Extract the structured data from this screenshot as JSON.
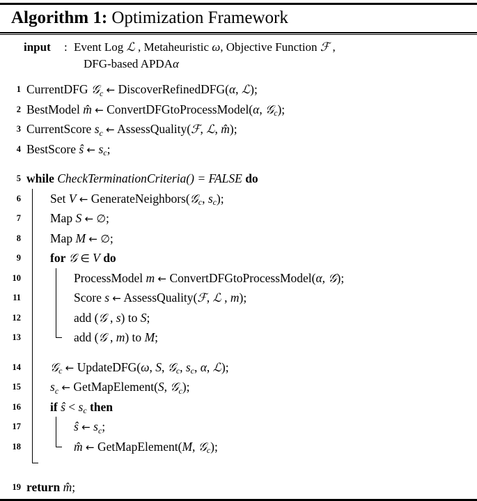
{
  "title": {
    "caption": "Algorithm 1:",
    "name": " Optimization Framework"
  },
  "input_block": {
    "keyword": "input",
    "colon": ":",
    "line1": "Event Log ℒ , Metaheuristic ω, Objective Function ℱ ,",
    "line2": "DFG-based APDA α"
  },
  "lines": [
    {
      "num": "1",
      "indent": 0,
      "text": "CurrentDFG 𝒢c ← DiscoverRefinedDFG(α, ℒ);"
    },
    {
      "num": "2",
      "indent": 0,
      "text": "BestModel m̂ ← ConvertDFGtoProcessModel(α, 𝒢c);"
    },
    {
      "num": "3",
      "indent": 0,
      "text": "CurrentScore sc ← AssessQuality(ℱ, ℒ, m̂);"
    },
    {
      "num": "4",
      "indent": 0,
      "text": "BestScore ŝ ← sc;"
    },
    {
      "num": "5",
      "indent": 0,
      "text": "while CheckTerminationCriteria() = FALSE do"
    },
    {
      "num": "6",
      "indent": 1,
      "text": "Set V ← GenerateNeighbors(𝒢c, sc);"
    },
    {
      "num": "7",
      "indent": 1,
      "text": "Map S ← ∅;"
    },
    {
      "num": "8",
      "indent": 1,
      "text": "Map M ← ∅;"
    },
    {
      "num": "9",
      "indent": 1,
      "text": "for 𝒢 ∈ V do"
    },
    {
      "num": "10",
      "indent": 2,
      "text": "ProcessModel m ← ConvertDFGtoProcessModel(α, 𝒢);"
    },
    {
      "num": "11",
      "indent": 2,
      "text": "Score s ← AssessQuality(ℱ, ℒ, m);"
    },
    {
      "num": "12",
      "indent": 2,
      "text": "add (𝒢, s) to S;"
    },
    {
      "num": "13",
      "indent": 2,
      "text": "add (𝒢, m) to M;"
    },
    {
      "num": "14",
      "indent": 1,
      "text": "𝒢c ← UpdateDFG(ω, S, 𝒢c, sc, α, ℒ);"
    },
    {
      "num": "15",
      "indent": 1,
      "text": "sc ← GetMapElement(S, 𝒢c);"
    },
    {
      "num": "16",
      "indent": 1,
      "text": "if ŝ < sc then"
    },
    {
      "num": "17",
      "indent": 2,
      "text": "ŝ ← sc;"
    },
    {
      "num": "18",
      "indent": 2,
      "text": "m̂ ← GetMapElement(M, 𝒢c);"
    },
    {
      "num": "19",
      "indent": 0,
      "text": "return m̂;"
    }
  ],
  "symbols": {
    "script_l": "ℒ",
    "script_f": "ℱ",
    "script_g": "𝒢",
    "omega": "ω",
    "alpha": "α",
    "arrow": "←",
    "emptyset": "∅",
    "elementof": "∈",
    "lessthan": "<",
    "equals": "="
  },
  "colors": {
    "ink": "#000000",
    "page": "#ffffff"
  }
}
